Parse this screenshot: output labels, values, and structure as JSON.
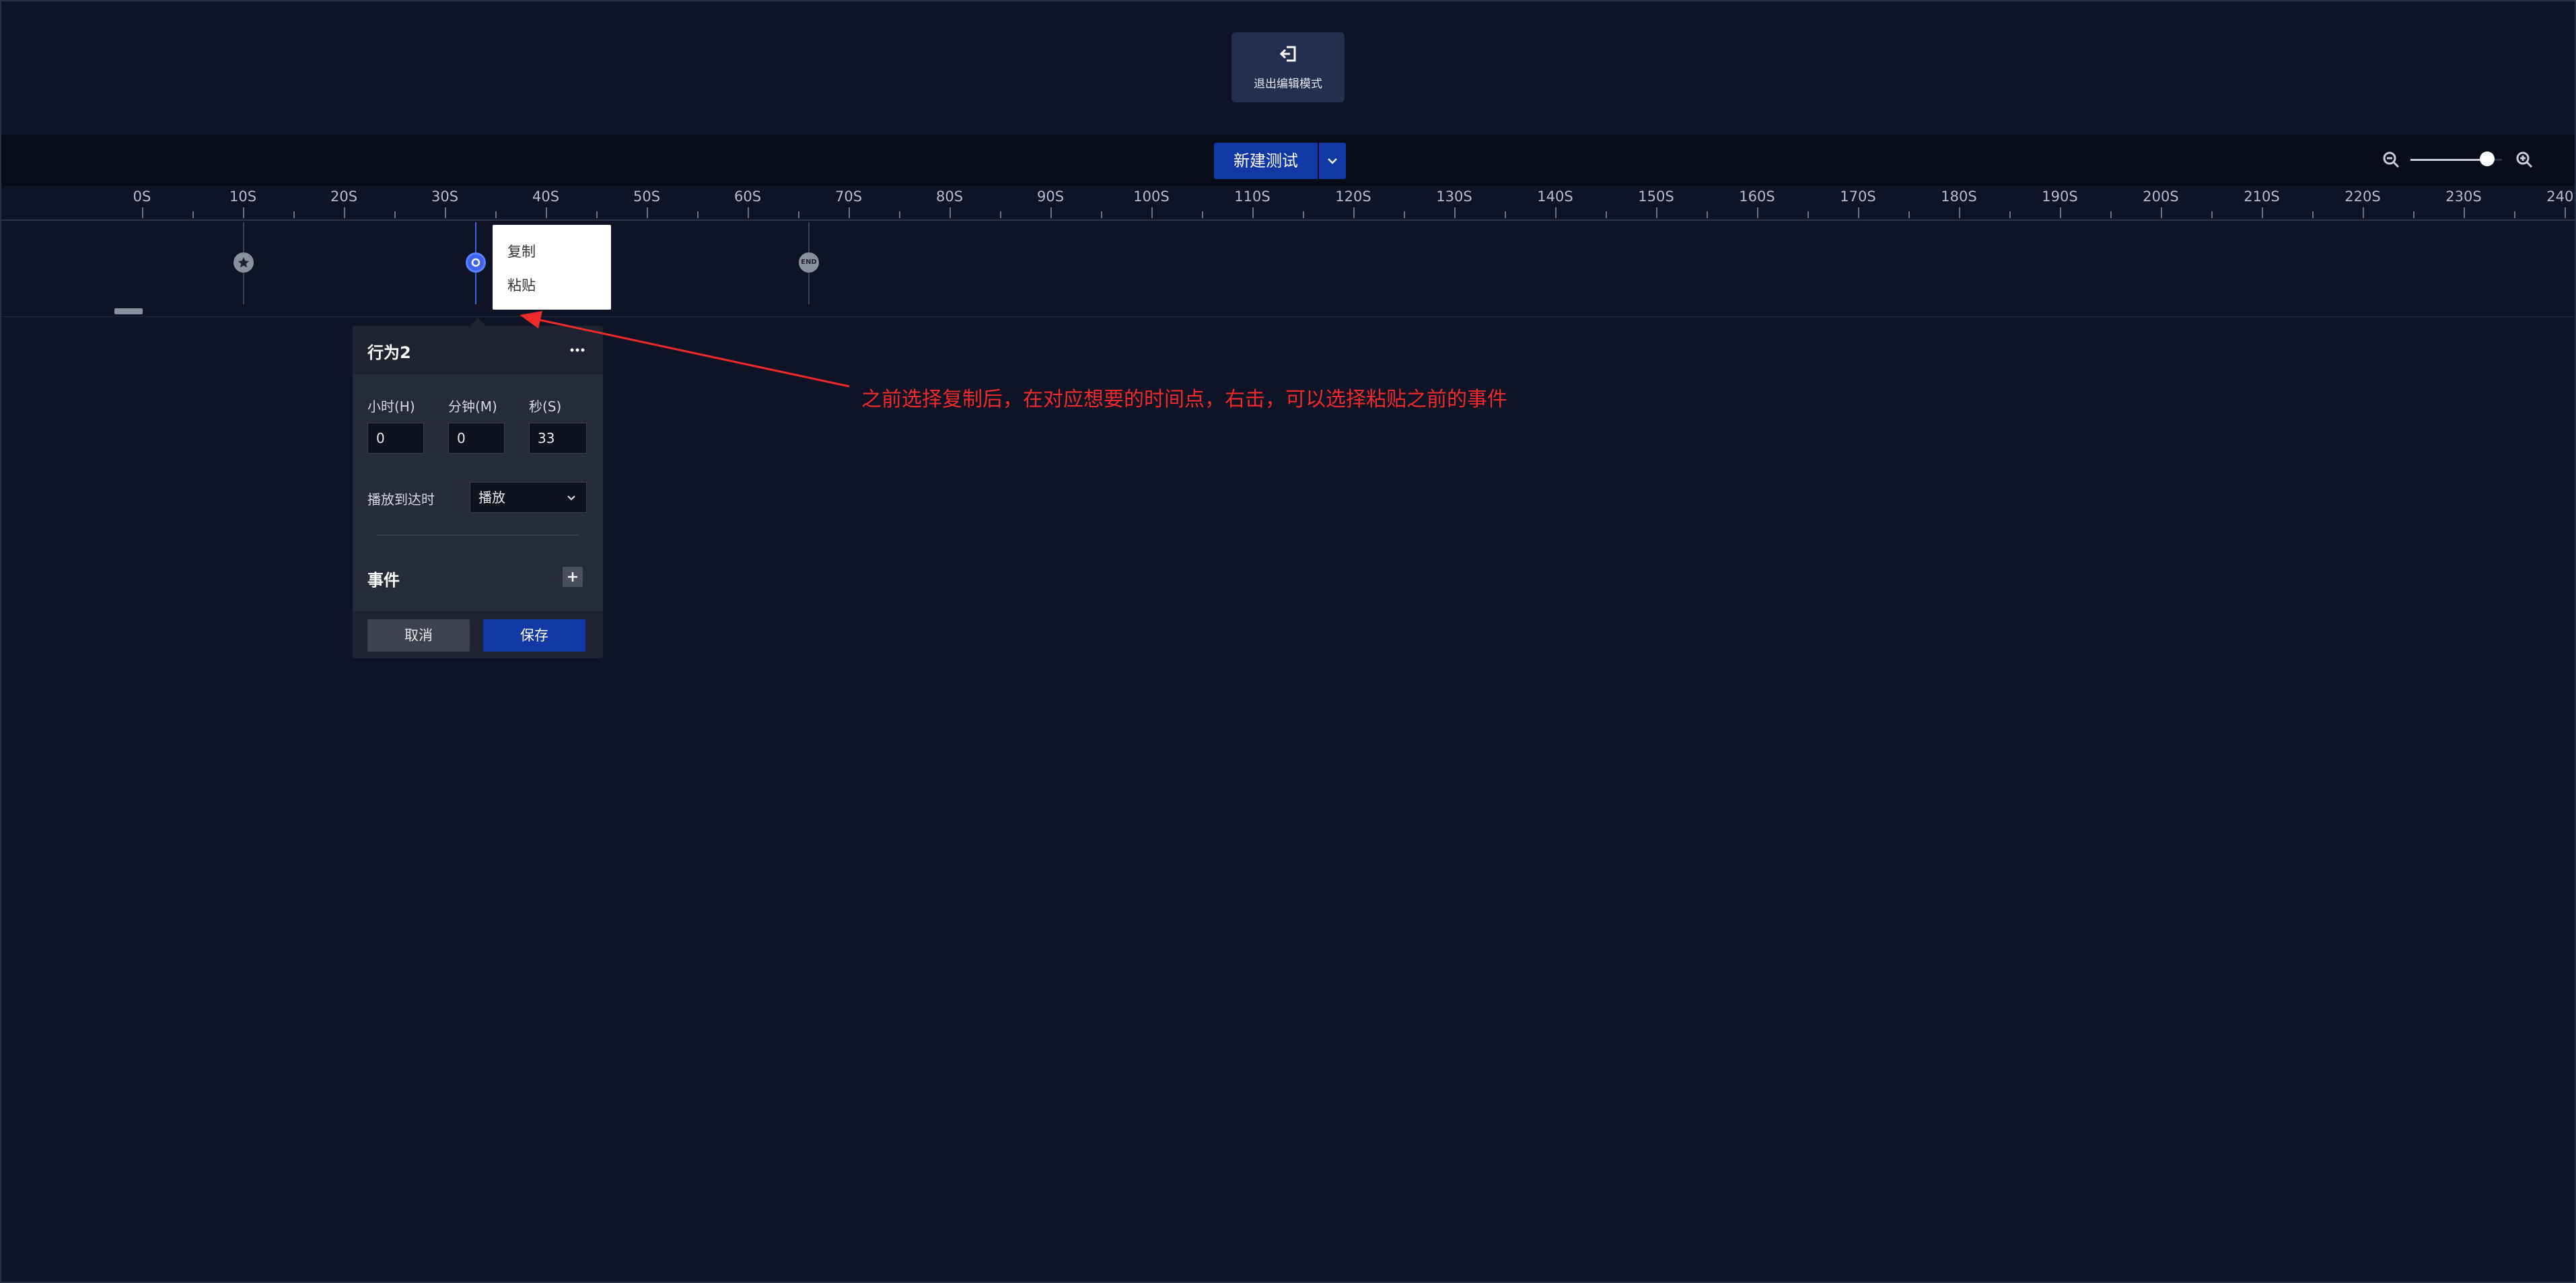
{
  "header": {
    "exit_label": "退出编辑模式"
  },
  "toolbar": {
    "new_test_label": "新建测试",
    "zoom_level": 0.84
  },
  "ruler": {
    "unit": "S",
    "step": 10,
    "labels": [
      "0S",
      "10S",
      "20S",
      "30S",
      "40S",
      "50S",
      "60S",
      "70S",
      "80S",
      "90S",
      "100S",
      "110S",
      "120S",
      "130S",
      "140S",
      "150S",
      "160S",
      "170S",
      "180S",
      "190S",
      "200S",
      "210S",
      "220S",
      "230S",
      "240S"
    ]
  },
  "timeline": {
    "end_label": "END"
  },
  "context_menu": {
    "copy": "复制",
    "paste": "粘贴"
  },
  "panel": {
    "title": "行为2",
    "hour_label": "小时(H)",
    "hour_value": "0",
    "minute_label": "分钟(M)",
    "minute_value": "0",
    "second_label": "秒(S)",
    "second_value": "33",
    "play_label": "播放到达时",
    "play_value": "播放",
    "events_label": "事件",
    "cancel_label": "取消",
    "save_label": "保存"
  },
  "annotation": {
    "text": "之前选择复制后，在对应想要的时间点，右击，可以选择粘贴之前的事件",
    "color": "#ee2a2a"
  },
  "colors": {
    "background": "#0e1325",
    "accent": "#1238a6",
    "marker_active": "#3d63e8"
  }
}
